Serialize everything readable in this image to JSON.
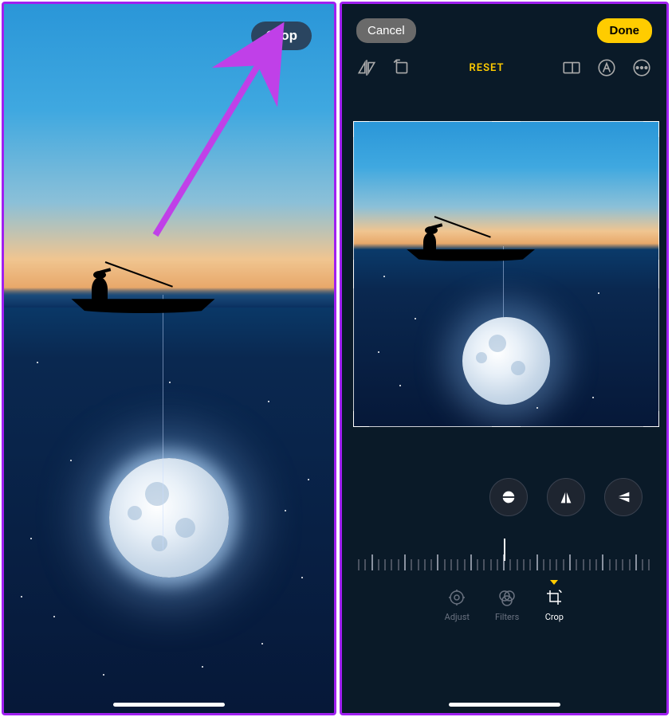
{
  "left": {
    "crop_button": "Crop"
  },
  "right": {
    "top_bar": {
      "cancel": "Cancel",
      "done": "Done"
    },
    "tool_bar": {
      "reset": "RESET"
    },
    "tabs": {
      "adjust": "Adjust",
      "filters": "Filters",
      "crop": "Crop",
      "active": "crop"
    }
  },
  "colors": {
    "accent_yellow": "#ffcc00",
    "overlay_border": "#a020f0"
  }
}
